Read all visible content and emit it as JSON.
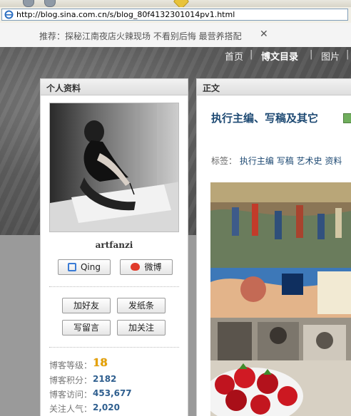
{
  "browser": {
    "url": "http://blog.sina.com.cn/s/blog_80f4132301014pv1.html"
  },
  "infobar": {
    "text": "推荐：探秘江南夜店火辣现场   不看别后悔  最营养搭配",
    "close_label": "✕"
  },
  "nav": {
    "items": [
      {
        "label": "首页"
      },
      {
        "label": "博文目录"
      },
      {
        "label": "图片"
      },
      {
        "label": "|"
      }
    ]
  },
  "profile": {
    "panel_title": "个人资料",
    "username": "artfanzi",
    "qing_label": "Qing",
    "weibo_label": "微博",
    "buttons": {
      "add_friend": "加好友",
      "send_note": "发纸条",
      "leave_message": "写留言",
      "follow": "加关注"
    },
    "stats": {
      "level_label": "博客等级：",
      "level_value": "18",
      "points_label": "博客积分：",
      "points_value": "2182",
      "visits_label": "博客访问：",
      "visits_value": "453,677",
      "followers_label": "关注人气：",
      "followers_value": "2,020"
    }
  },
  "article": {
    "panel_title": "正文",
    "title": "执行主编、写稿及其它",
    "tags_label": "标签：",
    "tags": [
      "执行主编",
      "写稿",
      "艺术史",
      "资料"
    ]
  },
  "colors": {
    "link_blue": "#1e4a73",
    "level_gold": "#e6a100"
  }
}
